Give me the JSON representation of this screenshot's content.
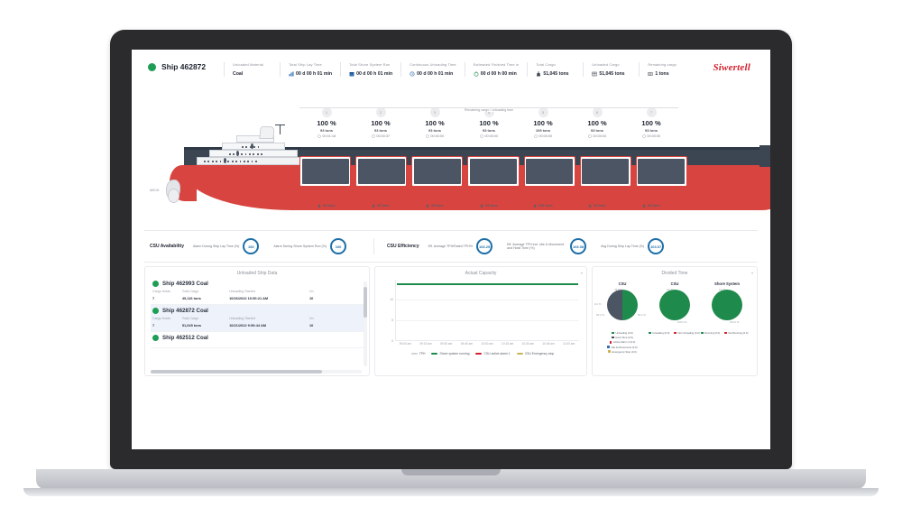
{
  "header": {
    "ship_status_icon": "green-status-dot",
    "ship_name": "Ship 462872",
    "brand": "Siwertell",
    "kpis": [
      {
        "label": "Unloaded Material",
        "value": "Coal",
        "icon": "none"
      },
      {
        "label": "Total Ship Lay Time",
        "value": "00 d 00 h 01 min",
        "icon": "chart-bars-icon"
      },
      {
        "label": "Total Shore System Run",
        "value": "00 d 00 h 01 min",
        "icon": "calendar-icon"
      },
      {
        "label": "Continuous Unloading Time",
        "value": "00 d 00 h 01 min",
        "icon": "clock-arrow-icon"
      },
      {
        "label": "Estimated Finished Time in",
        "value": "00 d 00 h 00 min",
        "icon": "stopwatch-icon"
      },
      {
        "label": "Total Cargo",
        "value": "51,045 tons",
        "icon": "cargo-bag-icon"
      },
      {
        "label": "Unloaded Cargo",
        "value": "51,045 tons",
        "icon": "unload-icon"
      },
      {
        "label": "Remaining cargo",
        "value": "1 tons",
        "icon": "remaining-icon"
      }
    ]
  },
  "ship_panel": {
    "band_label": "Remaining cargo / Unloading time",
    "draft_mark": "669.00",
    "holds": [
      {
        "number": "1",
        "percent": "100 %",
        "tons": "93 tons",
        "time": "00:01:18",
        "bottom_tons": "93 tons"
      },
      {
        "number": "2",
        "percent": "100 %",
        "tons": "93 tons",
        "time": "00:00:37",
        "bottom_tons": "93 tons"
      },
      {
        "number": "3",
        "percent": "100 %",
        "tons": "93 tons",
        "time": "00:00:00",
        "bottom_tons": "93 tons"
      },
      {
        "number": "4",
        "percent": "100 %",
        "tons": "93 tons",
        "time": "00:00:00",
        "bottom_tons": "93 tons"
      },
      {
        "number": "5",
        "percent": "100 %",
        "tons": "109 tons",
        "time": "00:00:00",
        "bottom_tons": "109 tons"
      },
      {
        "number": "6",
        "percent": "100 %",
        "tons": "93 tons",
        "time": "00:00:00",
        "bottom_tons": "93 tons"
      },
      {
        "number": "7",
        "percent": "100 %",
        "tons": "93 tons",
        "time": "00:00:00",
        "bottom_tons": "93 tons"
      }
    ]
  },
  "gauges": {
    "availability_title": "CSU Availability",
    "efficiency_title": "CSU Efficiency",
    "availability_items": [
      {
        "label": "Alarm During Ship Lay Time (%)",
        "value": "100"
      },
      {
        "label": "Alarm During Shore System Run (%)",
        "value": "100"
      }
    ],
    "efficiency_items": [
      {
        "label": "Eff. Average TPH/Rated TPH%",
        "value": "103.25"
      },
      {
        "label": "Eff. Average TPH incl. Idle & Movement and Hoist Time (%)",
        "value": "103.08"
      },
      {
        "label": "Avg During Ship Lay Time (%)",
        "value": "103.07"
      }
    ]
  },
  "unloaded_ship_data": {
    "title": "Unloaded Ship Data",
    "columns": [
      "Cargo Holds",
      "Total Cargo",
      "Unloading Started",
      "Un"
    ],
    "rows": [
      {
        "name": "Ship 462993 Coal",
        "cargo_holds": "7",
        "total_cargo": "49,116 tons",
        "unloading_started": "10/26/2022 10:50:21 AM",
        "unloading_finished": "10"
      },
      {
        "name": "Ship 462872 Coal",
        "cargo_holds": "7",
        "total_cargo": "51,045 tons",
        "unloading_started": "10/21/2022 9:59:44 AM",
        "unloading_finished": "10"
      },
      {
        "name": "Ship 462512 Coal",
        "cargo_holds": "",
        "total_cargo": "",
        "unloading_started": "",
        "unloading_finished": ""
      }
    ]
  },
  "chart_data": {
    "type": "line",
    "title": "Actual Capacity",
    "xlabel": "",
    "ylabel": "",
    "ylim": [
      0,
      15
    ],
    "yticks": [
      "0",
      "5",
      "10"
    ],
    "x": [
      "09:00 am",
      "09:15 am",
      "09:30 am",
      "09:45 am",
      "10:00 am",
      "10:15 am",
      "10:30 am",
      "10:45 am",
      "11:00 am"
    ],
    "grid": true,
    "legend_position": "bottom",
    "series": [
      {
        "name": "TPH",
        "color": "#cfd2d7",
        "values": [
          0,
          0,
          0,
          0,
          0,
          0,
          0,
          0,
          0
        ]
      },
      {
        "name": "Shore system running",
        "color": "#1e8a4c",
        "values": [
          14,
          14,
          14,
          14,
          14,
          14,
          14,
          14,
          14
        ]
      },
      {
        "name": "CSU active alarm 1",
        "color": "#d4202c",
        "values": [
          0,
          0,
          0,
          0,
          0,
          0,
          0,
          0,
          0
        ]
      },
      {
        "name": "CSU Emergency stop",
        "color": "#c9b458",
        "values": [
          0,
          0,
          0,
          0,
          0,
          0,
          0,
          0,
          0
        ]
      }
    ]
  },
  "divided_time": {
    "title": "Divided Time",
    "pies": [
      {
        "title": "CSU",
        "labels": {
          "top": "49.8 %",
          "left": "0.0 %",
          "bottom_left": "50.2 %",
          "right": "50.2 %"
        },
        "legend": [
          {
            "name": "Unloading (0.0)",
            "color": "#1e8a4c"
          },
          {
            "name": "Hoist Time (0.0)",
            "color": "#3c4552"
          },
          {
            "name": "Active Alarm 1 (0.0)",
            "color": "#d4202c"
          },
          {
            "name": "Idle & Movements (0.0)",
            "color": "#2f6fb5"
          },
          {
            "name": "Emergency Stop (0.0)",
            "color": "#c9b458"
          }
        ]
      },
      {
        "title": "CSU",
        "labels": {
          "top": "0.0 %",
          "bottom": "100.0 %"
        },
        "legend": [
          {
            "name": "Unloading (0.0)",
            "color": "#1e8a4c"
          },
          {
            "name": "Not Unloading (0.0)",
            "color": "#d4202c"
          }
        ]
      },
      {
        "title": "Shore System",
        "labels": {
          "top": "0.0 %",
          "bottom": "100.0 %"
        },
        "legend": [
          {
            "name": "Running (0.0)",
            "color": "#1e8a4c"
          },
          {
            "name": "Not Running (0.0)",
            "color": "#d4202c"
          }
        ]
      }
    ]
  },
  "colors": {
    "green": "#1e9e54",
    "red": "#d8443f",
    "brand_red": "#d4202c",
    "blue": "#1e6fa8",
    "dark": "#3c4552"
  }
}
